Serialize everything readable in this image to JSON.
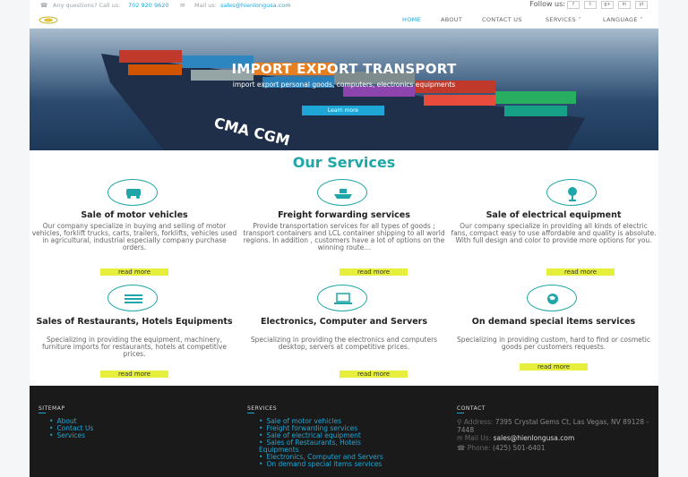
{
  "topbar": {
    "question_label": "Any questions? Call us:",
    "phone": "702 920 9620",
    "mail_label": "Mail us:",
    "email": "sales@hienlongusa.com",
    "follow_label": "Follow us:",
    "socials": [
      "f",
      "t",
      "g+",
      "in",
      "yt"
    ]
  },
  "nav": {
    "items": [
      "HOME",
      "ABOUT",
      "CONTACT US",
      "SERVICES ˅",
      "LANGUAGE ˅"
    ]
  },
  "hero": {
    "title": "IMPORT EXPORT TRANSPORT",
    "subtitle": "import export personal goods, computers, electronics equipments",
    "cta": "Learn more",
    "ship_text": "CMA CGM"
  },
  "services": {
    "heading": "Our Services",
    "items": [
      {
        "title": "Sale of motor vehicles",
        "icon": "car-icon",
        "desc": "Our company specialize in buying and selling of motor vehicles, forklift trucks, carts, trailers, forklifts, vehicles used in agricultural, industrial especially company purchase orders.",
        "more": "read more"
      },
      {
        "title": "Freight forwarding services",
        "icon": "ship-icon",
        "desc": "Provide transportation services for all types of goods ; transport containers and LCL container shipping to all world regions. In addition , customers have a lot of options on the winning route...",
        "more": "read more"
      },
      {
        "title": "Sale of electrical equipment",
        "icon": "fan-icon",
        "desc": "Our company specialize in providing all kinds of electric fans, compact easy to use affordable and quality is absolute. With full design and color to provide more options for you.",
        "more": "read more"
      },
      {
        "title": "Sales of Restaurants, Hotels Equipments",
        "icon": "hotel-icon",
        "desc": "Specializing in providing the equipment, machinery, furniture imports for restaurants, hotels at competitive prices.",
        "more": "read more"
      },
      {
        "title": "Electronics, Computer and Servers",
        "icon": "laptop-icon",
        "desc": "Specializing in providing the electronics and computers desktop, servers at competitive prices.",
        "more": "read more"
      },
      {
        "title": "On demand special items services",
        "icon": "globe-icon",
        "desc": "Specializing in providing custom, hard to find or cosmetic goods per customers requests.",
        "more": "read more"
      }
    ]
  },
  "footer": {
    "sitemap_heading": "SITEMAP",
    "sitemap": [
      "About",
      "Contact Us",
      "Services"
    ],
    "services_heading": "SERVICES",
    "services": [
      "Sale of motor vehicles",
      "Freight forwarding services",
      "Sale of electrical equipment",
      "Sales of Restaurants, Hotels Equipments",
      "Electronics, Computer and Servers",
      "On demand special items services"
    ],
    "contact_heading": "CONTACT",
    "address_label": "Address:",
    "address": "7395 Crystal Gems Ct, Las Vegas, NV 89128 - 7448",
    "mail_label": "Mail Us:",
    "email": "sales@hienlongusa.com",
    "phone_label": "Phone:",
    "phone": "(425) 501-6401"
  },
  "colors": {
    "accent": "#1ea7d6",
    "teal": "#1fa6a8",
    "button": "#e6f03c",
    "footer": "#1a1a1a"
  }
}
